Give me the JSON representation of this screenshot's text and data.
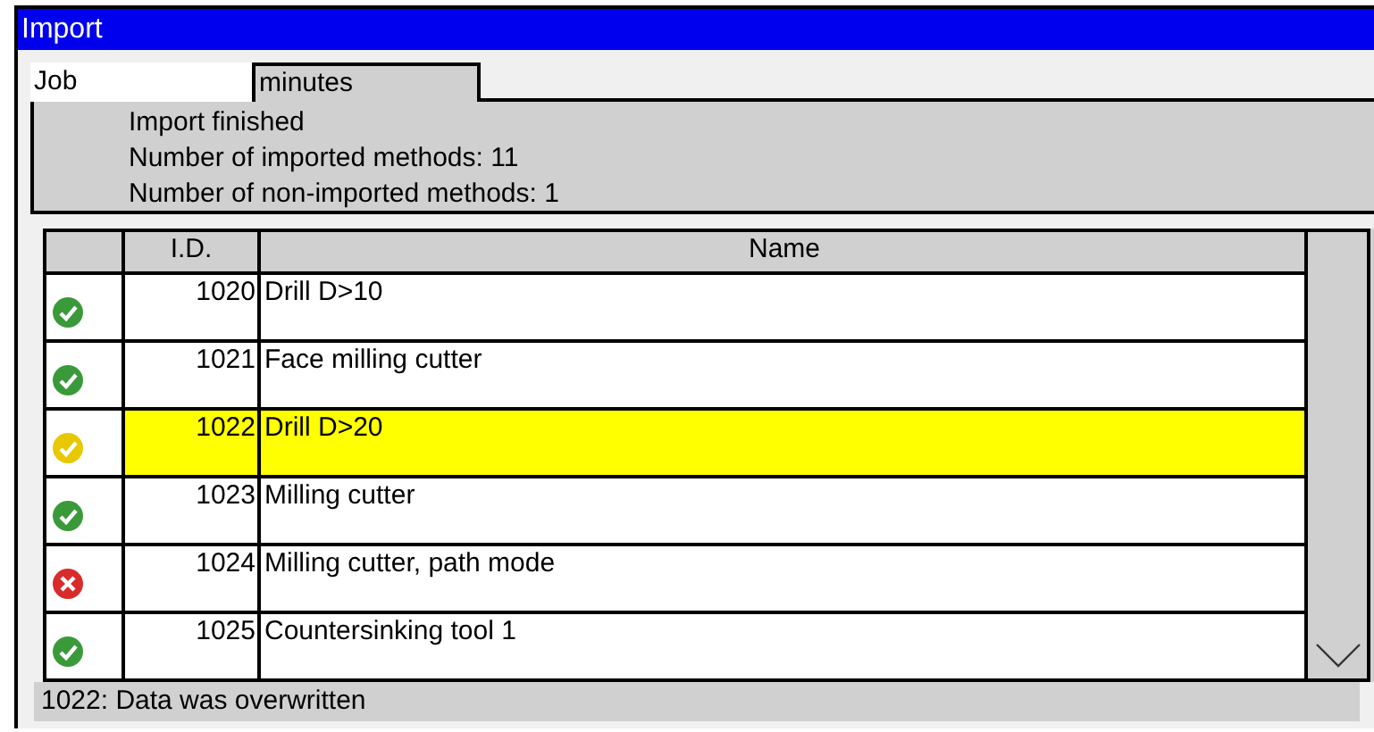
{
  "window": {
    "title": "Import"
  },
  "tabs": [
    {
      "label": "Job",
      "selected": false
    },
    {
      "label": "minutes",
      "selected": true
    }
  ],
  "summary": [
    "Import finished",
    "Number of imported methods: 11",
    "Number of non-imported methods: 1"
  ],
  "table": {
    "columns": [
      "I.D.",
      "Name"
    ],
    "rows": [
      {
        "kind": "ok",
        "id": "1020",
        "name": "Drill D>10",
        "selected": false
      },
      {
        "kind": "ok",
        "id": "1021",
        "name": "Face milling cutter",
        "selected": false
      },
      {
        "kind": "warning",
        "id": "1022",
        "name": "Drill D>20",
        "selected": true
      },
      {
        "kind": "ok",
        "id": "1023",
        "name": "Milling cutter",
        "selected": false
      },
      {
        "kind": "error",
        "id": "1024",
        "name": "Milling cutter, path mode",
        "selected": false
      },
      {
        "kind": "ok",
        "id": "1025",
        "name": "Countersinking tool 1",
        "selected": false
      }
    ]
  },
  "status_bar": "1022: Data was overwritten"
}
